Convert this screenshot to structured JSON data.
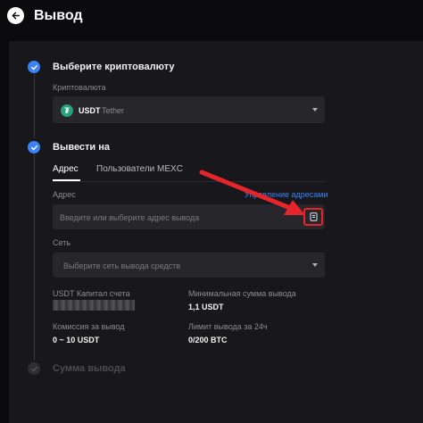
{
  "header": {
    "title": "Вывод"
  },
  "steps": [
    {
      "title": "Выберите криптовалюту"
    },
    {
      "title": "Вывести на"
    },
    {
      "title": "Сумма вывода"
    }
  ],
  "crypto": {
    "label": "Криптовалюта",
    "ticker": "USDT",
    "name": "Tether",
    "icon_glyph": "₮",
    "icon_color": "#26a17b"
  },
  "tabs": [
    {
      "label": "Адрес",
      "active": true
    },
    {
      "label": "Пользователи MEXC",
      "active": false
    }
  ],
  "address": {
    "label": "Адрес",
    "manage_link": "Управление адресами",
    "placeholder": "Введите или выберите адрес вывода",
    "book_icon": "address-book-icon",
    "highlight_color": "#e5252a"
  },
  "network": {
    "label": "Сеть",
    "placeholder": "Выберите сеть вывода средств"
  },
  "info": {
    "capital_label": "USDT Капитал счета",
    "min_label": "Минимальная сумма вывода",
    "min_value": "1,1 USDT",
    "fee_label": "Комиссия за вывод",
    "fee_value": "0 ~ 10 USDT",
    "limit_label": "Лимит вывода за 24ч",
    "limit_value": "0/200 BTC"
  },
  "colors": {
    "accent": "#3b82f6",
    "annotation_arrow": "#e5252a"
  }
}
